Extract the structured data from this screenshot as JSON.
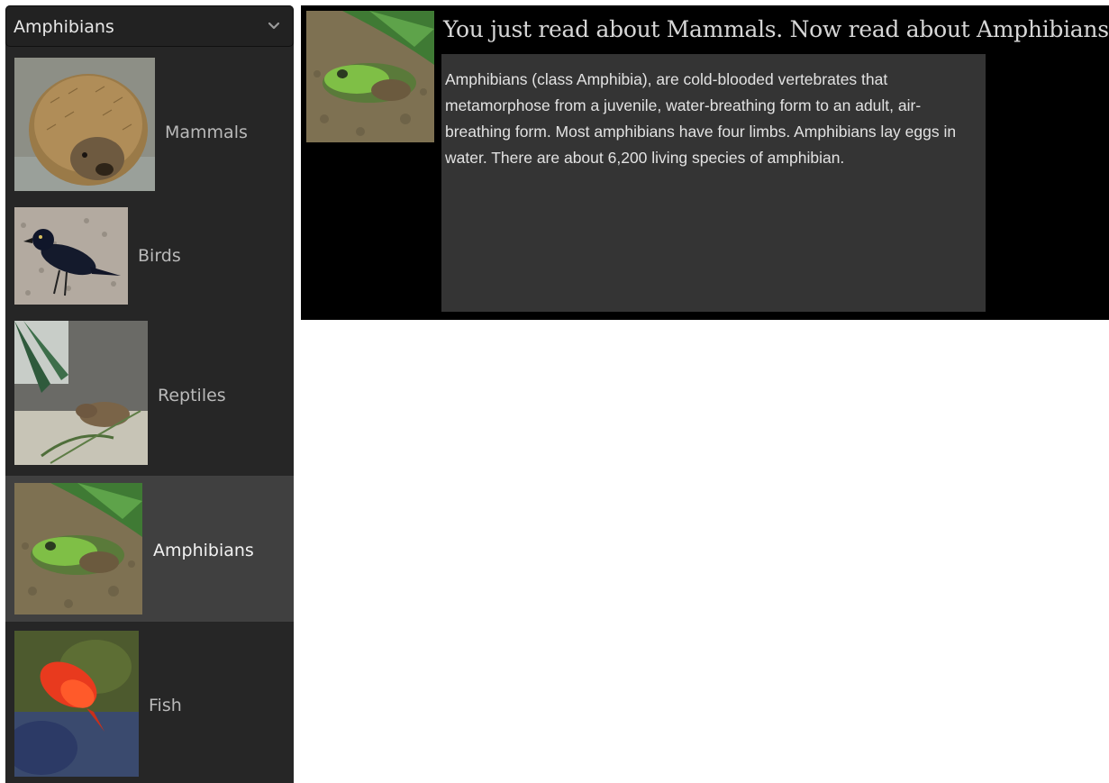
{
  "dropdown": {
    "selected_label": "Amphibians",
    "icon": "chevron-down-icon",
    "items": [
      {
        "label": "Mammals",
        "icon": "hedgehog-photo"
      },
      {
        "label": "Birds",
        "icon": "blackbird-photo"
      },
      {
        "label": "Reptiles",
        "icon": "lizard-photo"
      },
      {
        "label": "Amphibians",
        "icon": "frog-photo",
        "selected": true
      },
      {
        "label": "Fish",
        "icon": "koi-fish-photo"
      }
    ]
  },
  "content": {
    "heading": "You just read about Mammals. Now read about Amphibians:",
    "image": "frog-photo",
    "description": "Amphibians (class Amphibia), are cold-blooded vertebrates that metamorphose from a juvenile, water-breathing form to an adult, air-breathing form. Most amphibians have four limbs. Amphibians lay eggs in water. There are about 6,200 living species of amphibian."
  },
  "colors": {
    "dropdown_bg": "#262626",
    "selected_item_bg": "#404040",
    "panel_bg": "#000000",
    "description_bg": "#343434"
  }
}
